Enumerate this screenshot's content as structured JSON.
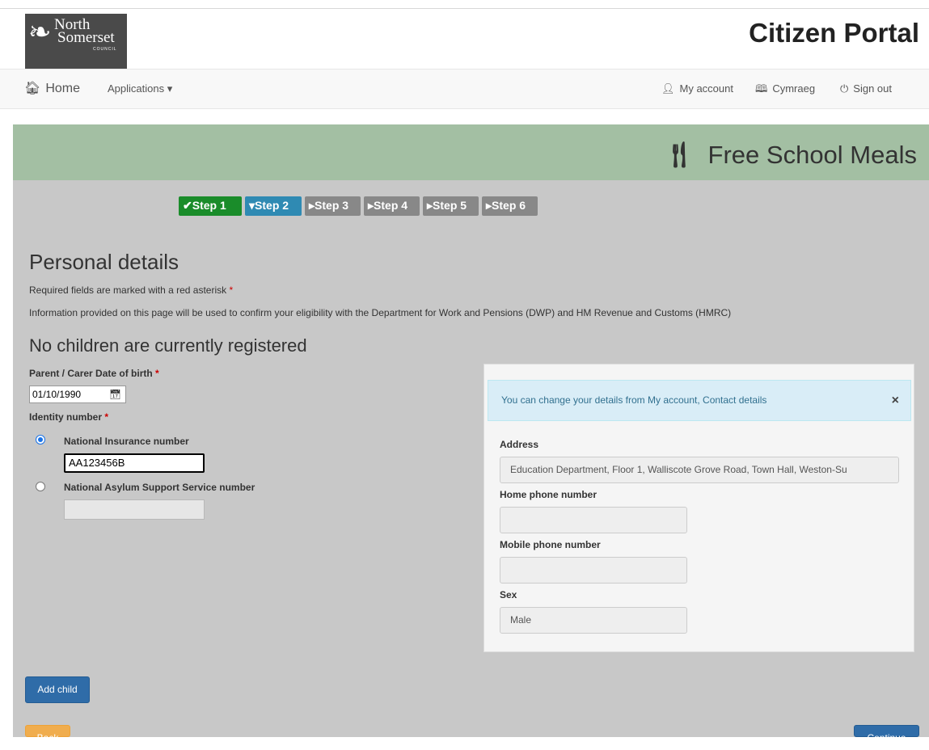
{
  "header": {
    "logo": {
      "line1": "North",
      "line2": "Somerset",
      "line3": "COUNCIL"
    },
    "portal_title": "Citizen Portal"
  },
  "nav": {
    "home": {
      "icon": "home-icon",
      "label": "Home"
    },
    "applications": {
      "label": "Applications",
      "icon": "caret-down-icon"
    },
    "my_account": {
      "icon": "user-icon",
      "label": "My account"
    },
    "cymraeg": {
      "icon": "book-icon",
      "label": "Cymraeg"
    },
    "sign_out": {
      "icon": "power-icon",
      "label": "Sign out"
    }
  },
  "service": {
    "icon": "cutlery-icon",
    "title": "Free School Meals"
  },
  "steps": [
    {
      "label": "Step 1",
      "state": "complete",
      "icon": "check-icon"
    },
    {
      "label": "Step 2",
      "state": "current",
      "icon": "caret-down-icon"
    },
    {
      "label": "Step 3",
      "state": "pending",
      "icon": "caret-right-icon"
    },
    {
      "label": "Step 4",
      "state": "pending",
      "icon": "caret-right-icon"
    },
    {
      "label": "Step 5",
      "state": "pending",
      "icon": "caret-right-icon"
    },
    {
      "label": "Step 6",
      "state": "pending",
      "icon": "caret-right-icon"
    }
  ],
  "form": {
    "heading": "Personal details",
    "required_note": "Required fields are marked with a red asterisk",
    "info": "Information provided on this page will be used to confirm your eligibility with the Department for Work and Pensions (DWP) and HM Revenue and Customs (HMRC)",
    "children_heading": "No children are currently registered",
    "dob_label": "Parent / Carer Date of birth",
    "dob_value": "01/10/1990",
    "identity_label": "Identity number",
    "ni_label": "National Insurance number",
    "ni_value": "AA123456B",
    "ni_selected": true,
    "nass_label": "National Asylum Support Service number",
    "nass_value": ""
  },
  "contact_panel": {
    "alert_text": "You can change your details from My account, Contact details",
    "alert_close": "×",
    "address_label": "Address",
    "address_value": "Education Department, Floor 1, Walliscote Grove Road, Town Hall, Weston-Su",
    "home_phone_label": "Home phone number",
    "home_phone_value": "",
    "mobile_label": "Mobile phone number",
    "mobile_value": "",
    "sex_label": "Sex",
    "sex_value": "Male"
  },
  "buttons": {
    "add_child": "Add child",
    "back": "Back",
    "continue": "Continue"
  },
  "colors": {
    "step_complete": "#1a8c2a",
    "step_current": "#2f8ab3",
    "step_pending": "#888888",
    "band": "#a3bfa3",
    "primary": "#2f6ca8",
    "warning": "#f0ad4e"
  }
}
